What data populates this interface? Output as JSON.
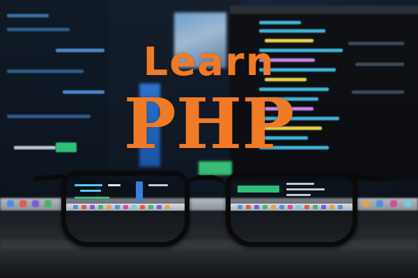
{
  "title": {
    "line1": "Learn",
    "line2": "PHP",
    "color": "#f07a26"
  },
  "scene": {
    "subject": "eyeglasses-on-desk",
    "background": "blurred-code-monitors"
  }
}
